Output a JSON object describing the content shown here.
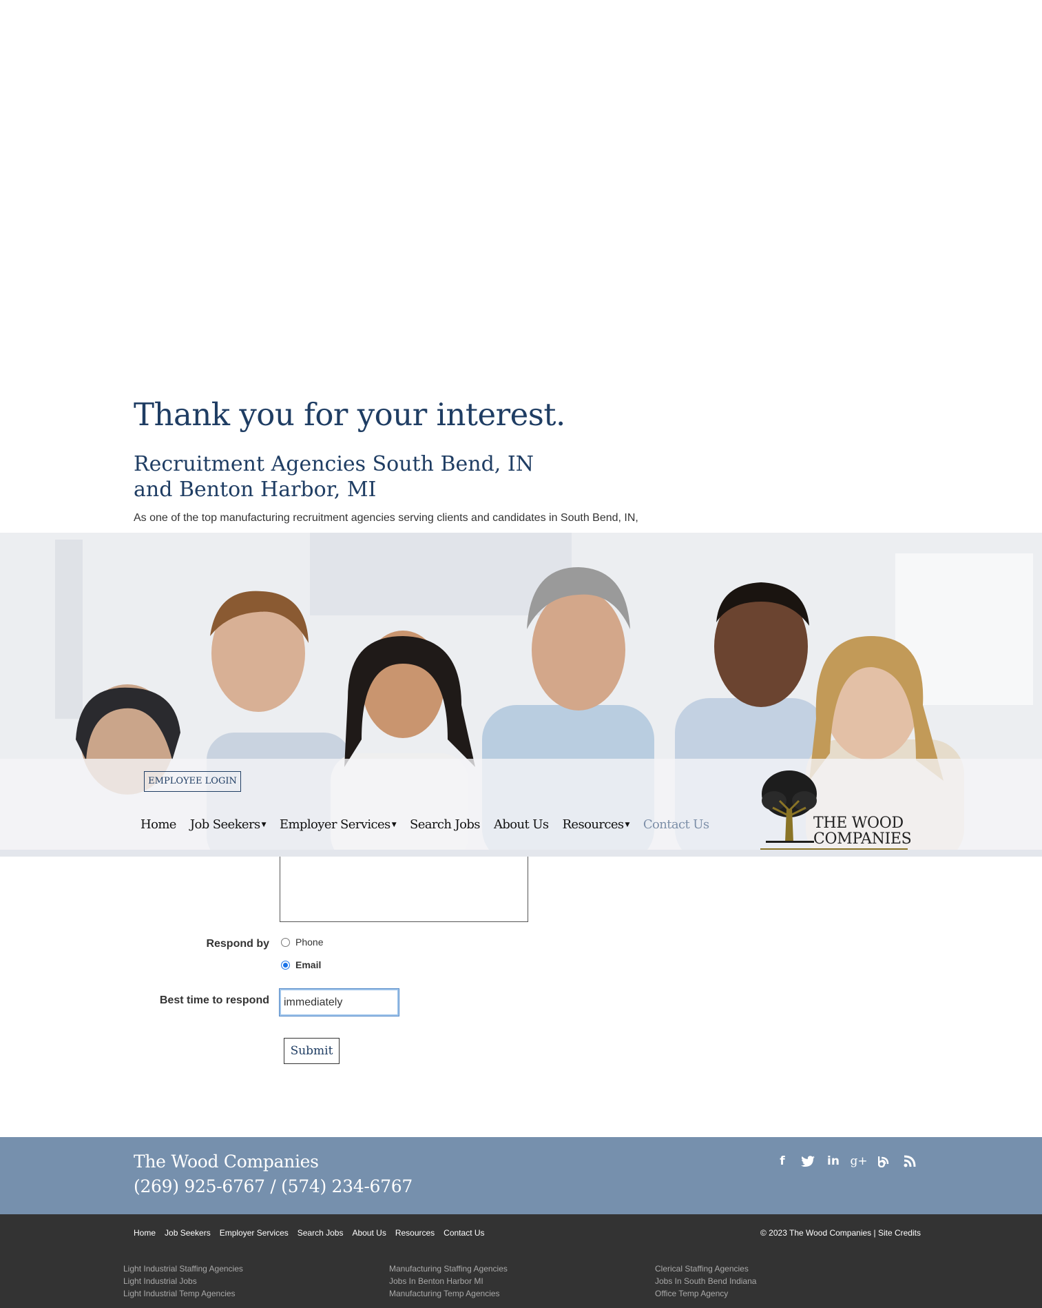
{
  "intro": {
    "heading": "Thank you for your interest.",
    "subheading": "Recruitment Agencies South Bend, IN and Benton Harbor, MI",
    "paragraph": "As one of the top manufacturing recruitment agencies serving clients and candidates in South Bend, IN,"
  },
  "header": {
    "employee_login": "EMPLOYEE LOGIN",
    "menu": [
      {
        "label": "Home",
        "dropdown": false
      },
      {
        "label": "Job Seekers",
        "dropdown": true
      },
      {
        "label": "Employer Services",
        "dropdown": true
      },
      {
        "label": "Search Jobs",
        "dropdown": false
      },
      {
        "label": "About Us",
        "dropdown": false
      },
      {
        "label": "Resources",
        "dropdown": true
      },
      {
        "label": "Contact Us",
        "dropdown": false,
        "active": true
      }
    ],
    "logo_line1": "THE WOOD",
    "logo_line2": "COMPANIES"
  },
  "form": {
    "respond_by_label": "Respond by",
    "options": [
      {
        "label": "Phone",
        "checked": false
      },
      {
        "label": "Email",
        "checked": true
      }
    ],
    "best_time_label": "Best time to respond",
    "best_time_value": "immediately",
    "submit_label": "Submit"
  },
  "footer": {
    "company": "The Wood Companies",
    "phone": "(269) 925-6767 / (574) 234-6767",
    "social_icons": [
      "facebook-icon",
      "twitter-icon",
      "linkedin-icon",
      "google-plus-icon",
      "blog-icon",
      "rss-icon"
    ],
    "nav": [
      "Home",
      "Job Seekers",
      "Employer Services",
      "Search Jobs",
      "About Us",
      "Resources",
      "Contact Us"
    ],
    "copyright": "© 2023 The Wood Companies | ",
    "site_credits": "Site Credits",
    "columns": [
      [
        "Light Industrial Staffing Agencies",
        "Light Industrial Jobs",
        "Light Industrial Temp Agencies"
      ],
      [
        "Manufacturing Staffing Agencies",
        "Jobs In Benton Harbor MI",
        "Manufacturing Temp Agencies"
      ],
      [
        "Clerical Staffing Agencies",
        "Jobs In South Bend Indiana",
        "Office Temp Agency"
      ]
    ]
  },
  "colors": {
    "heading": "#1f3d63",
    "footer_top": "#7690ad",
    "footer_bottom": "#333333",
    "active_nav": "#7d8fa8"
  }
}
